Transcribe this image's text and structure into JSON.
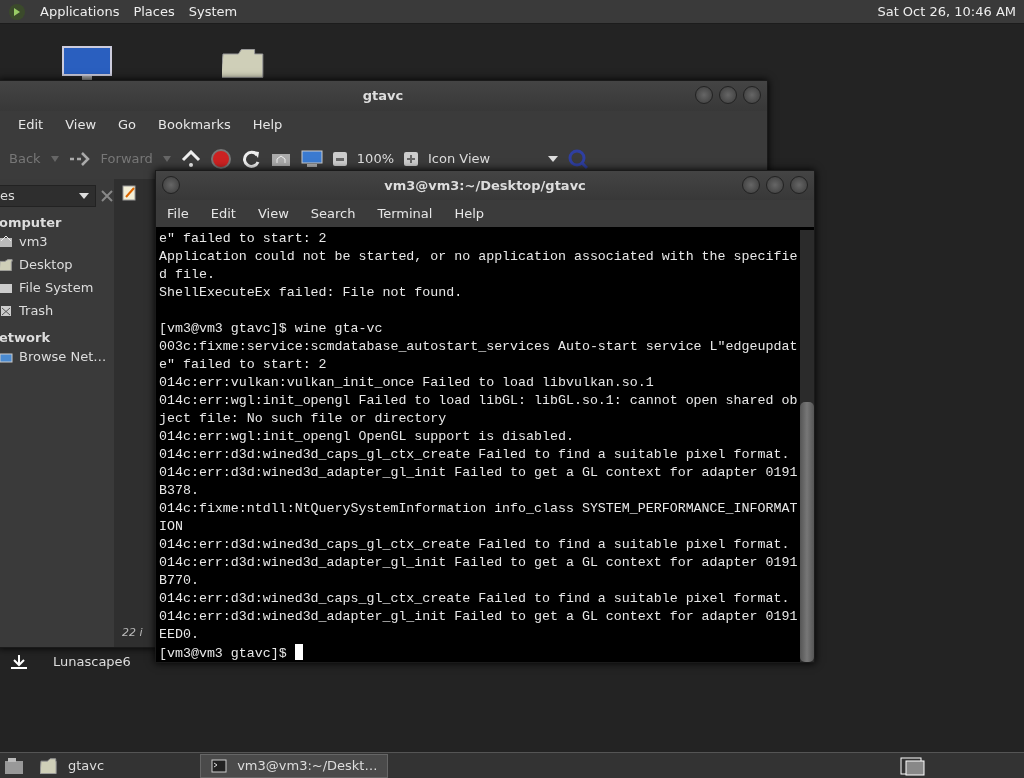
{
  "top_panel": {
    "menus": [
      "Applications",
      "Places",
      "System"
    ],
    "clock": "Sat Oct 26, 10:46 AM"
  },
  "desktop_icons": [
    {
      "kind": "monitor"
    },
    {
      "kind": "folder"
    },
    {
      "kind": "download",
      "label": "Lunascape6"
    }
  ],
  "file_manager": {
    "title": "gtavc",
    "menu": [
      "Edit",
      "View",
      "Go",
      "Bookmarks",
      "Help"
    ],
    "toolbar": {
      "back": {
        "label": "Back",
        "disabled": true
      },
      "forward": {
        "label": "Forward",
        "disabled": true
      },
      "zoom": "100%",
      "view": "Icon View"
    },
    "sidebar": {
      "selector": "es",
      "sections": [
        {
          "heading": "omputer",
          "items": [
            {
              "label": "vm3",
              "kind": "home"
            },
            {
              "label": "Desktop",
              "kind": "folder"
            },
            {
              "label": "File System",
              "kind": "drive"
            },
            {
              "label": "Trash",
              "kind": "trash"
            }
          ]
        },
        {
          "heading": "etwork",
          "items": [
            {
              "label": "Browse Net…",
              "kind": "network"
            }
          ]
        }
      ]
    },
    "status": "22 i"
  },
  "terminal": {
    "title": "vm3@vm3:~/Desktop/gtavc",
    "menu": [
      "File",
      "Edit",
      "View",
      "Search",
      "Terminal",
      "Help"
    ],
    "blocks": [
      [
        "e\" failed to start: 2",
        "Application could not be started, or no application associated with the specifie",
        "d file.",
        "ShellExecuteEx failed: File not found."
      ],
      [
        "[vm3@vm3 gtavc]$ wine gta-vc",
        "003c:fixme:service:scmdatabase_autostart_services Auto-start service L\"edgeupdat",
        "e\" failed to start: 2",
        "014c:err:vulkan:vulkan_init_once Failed to load libvulkan.so.1",
        "014c:err:wgl:init_opengl Failed to load libGL: libGL.so.1: cannot open shared ob",
        "ject file: No such file or directory",
        "014c:err:wgl:init_opengl OpenGL support is disabled.",
        "014c:err:d3d:wined3d_caps_gl_ctx_create Failed to find a suitable pixel format.",
        "014c:err:d3d:wined3d_adapter_gl_init Failed to get a GL context for adapter 0191",
        "B378.",
        "014c:fixme:ntdll:NtQuerySystemInformation info_class SYSTEM_PERFORMANCE_INFORMAT",
        "ION",
        "014c:err:d3d:wined3d_caps_gl_ctx_create Failed to find a suitable pixel format.",
        "014c:err:d3d:wined3d_adapter_gl_init Failed to get a GL context for adapter 0191",
        "B770.",
        "014c:err:d3d:wined3d_caps_gl_ctx_create Failed to find a suitable pixel format.",
        "014c:err:d3d:wined3d_adapter_gl_init Failed to get a GL context for adapter 0191",
        "EED0."
      ]
    ],
    "prompt": "[vm3@vm3 gtavc]$"
  },
  "taskbar": {
    "buttons": [
      {
        "label": "gtavc",
        "kind": "folder",
        "selected": false
      },
      {
        "label": "vm3@vm3:~/Deskt…",
        "kind": "terminal",
        "selected": true
      }
    ]
  }
}
